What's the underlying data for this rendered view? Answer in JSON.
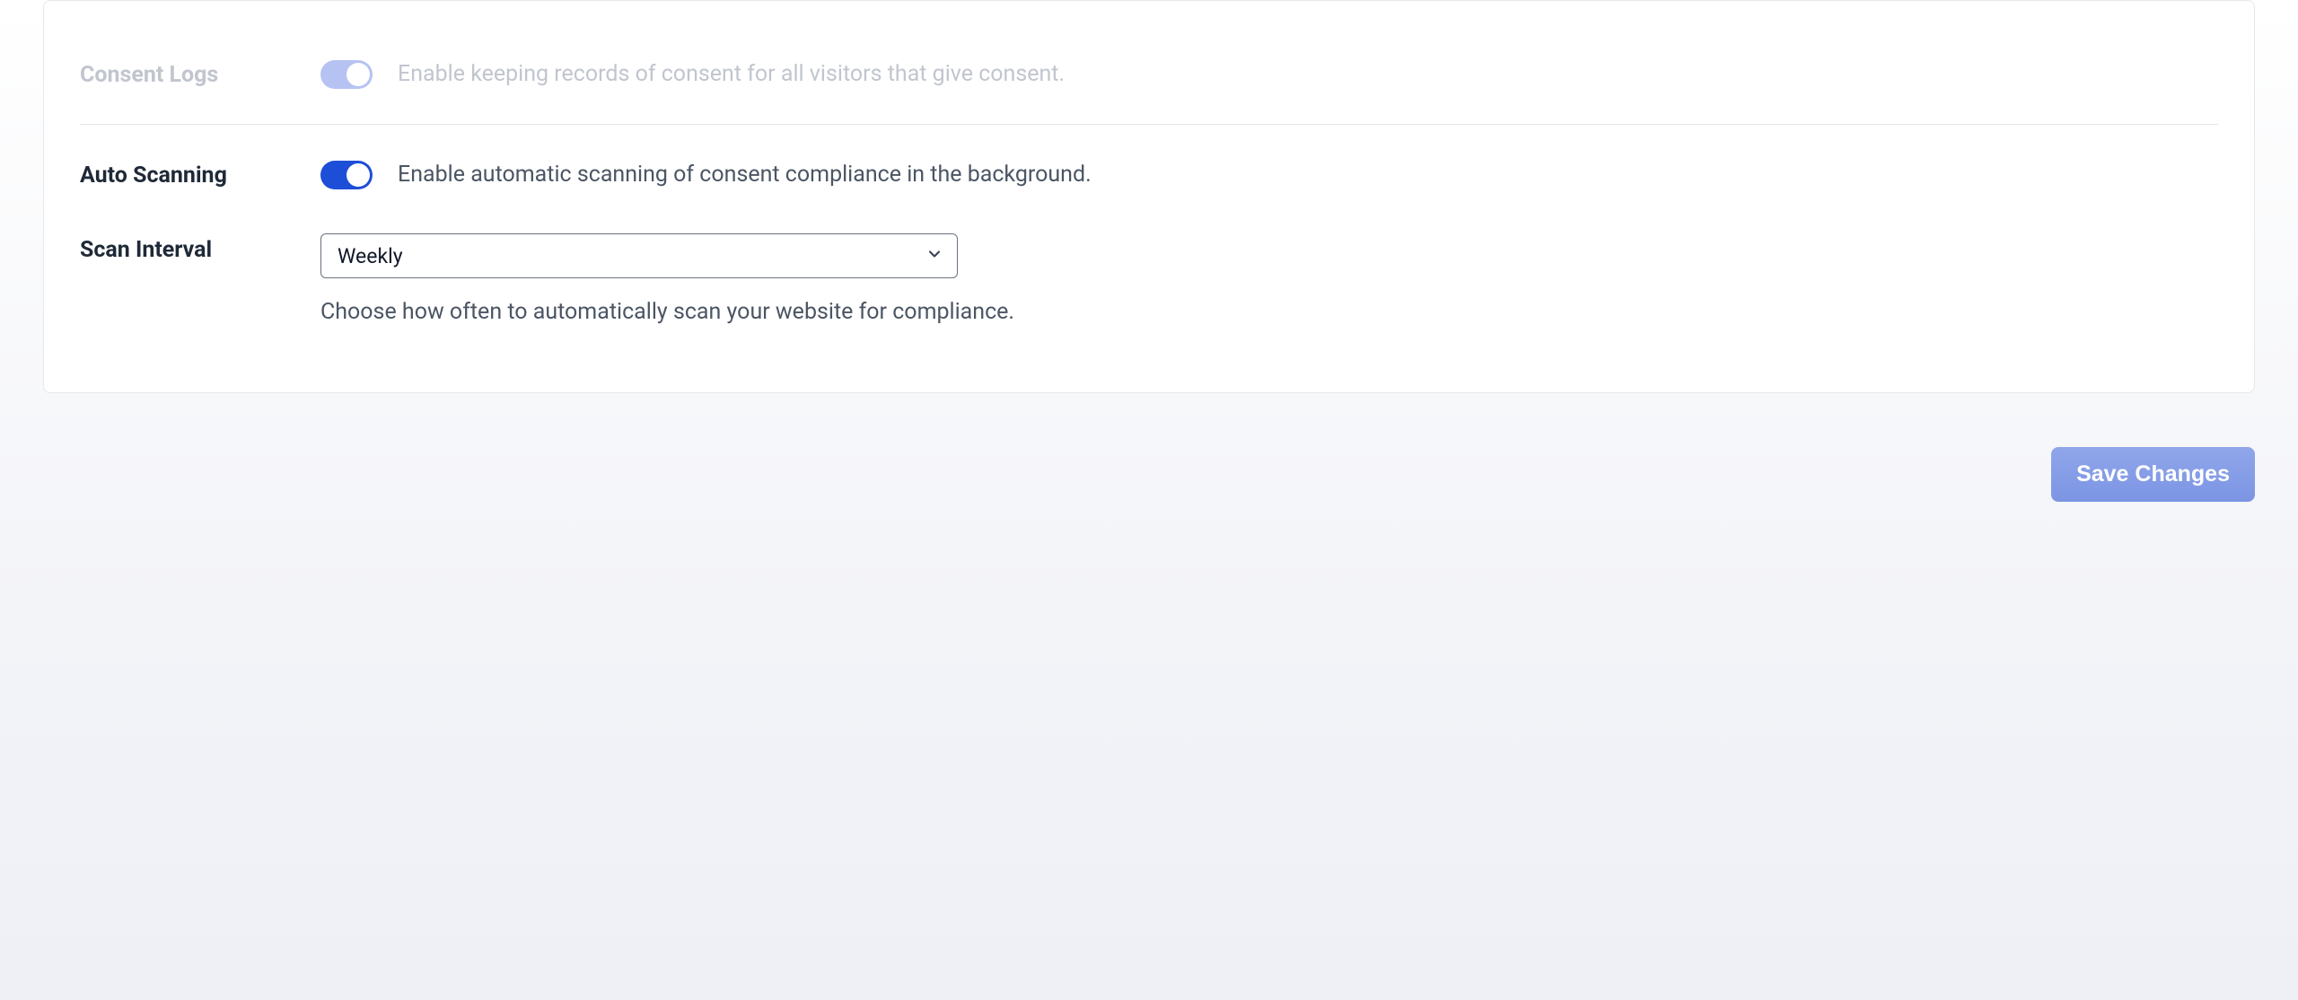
{
  "consent_logs": {
    "label": "Consent Logs",
    "description": "Enable keeping records of consent for all visitors that give consent.",
    "enabled": true,
    "disabled_row": true
  },
  "auto_scanning": {
    "label": "Auto Scanning",
    "description": "Enable automatic scanning of consent compliance in the background.",
    "enabled": true
  },
  "scan_interval": {
    "label": "Scan Interval",
    "selected": "Weekly",
    "help": "Choose how often to automatically scan your website for compliance."
  },
  "footer": {
    "save_label": "Save Changes"
  }
}
